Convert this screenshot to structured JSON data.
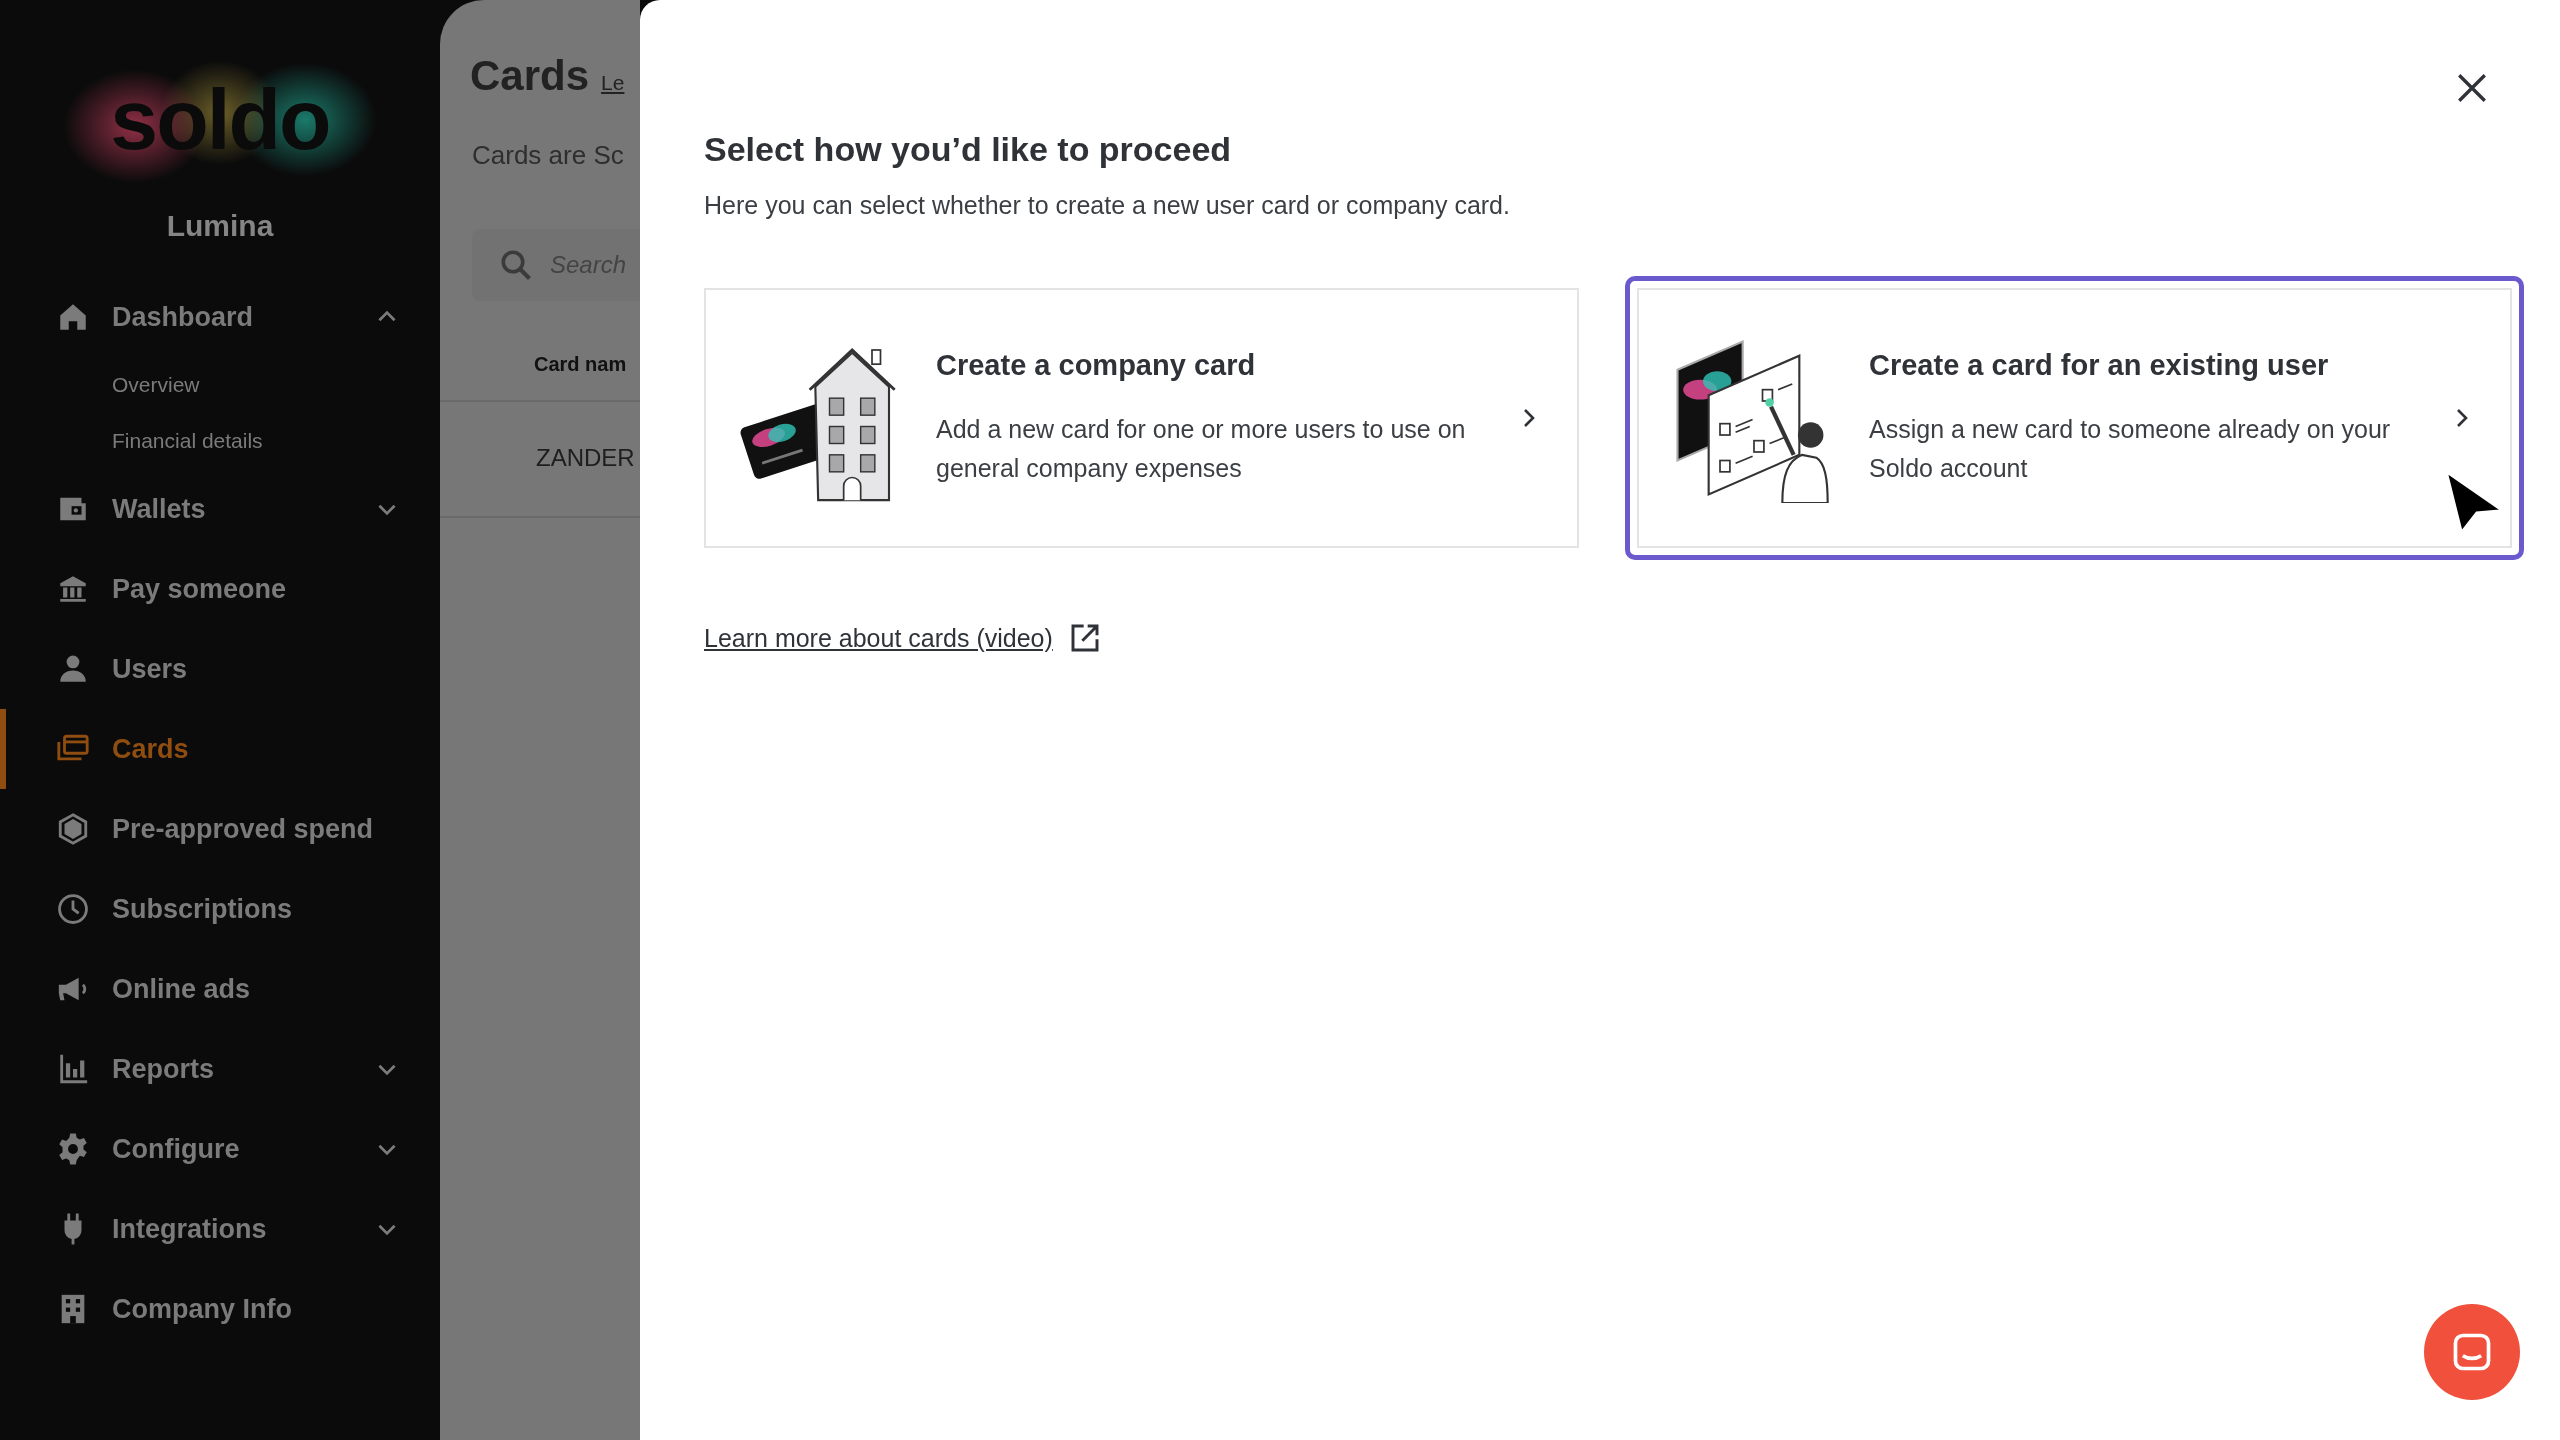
{
  "sidebar": {
    "logo": "soldo",
    "company": "Lumina",
    "items": [
      {
        "label": "Dashboard",
        "selected": false,
        "expanded": true,
        "children": [
          {
            "label": "Overview"
          },
          {
            "label": "Financial details"
          }
        ]
      },
      {
        "label": "Wallets",
        "selected": false,
        "expanded": false
      },
      {
        "label": "Pay someone",
        "selected": false
      },
      {
        "label": "Users",
        "selected": false
      },
      {
        "label": "Cards",
        "selected": true
      },
      {
        "label": "Pre-approved spend",
        "selected": false
      },
      {
        "label": "Subscriptions",
        "selected": false
      },
      {
        "label": "Online ads",
        "selected": false
      },
      {
        "label": "Reports",
        "selected": false,
        "expanded": false
      },
      {
        "label": "Configure",
        "selected": false,
        "expanded": false
      },
      {
        "label": "Integrations",
        "selected": false,
        "expanded": false
      },
      {
        "label": "Company Info",
        "selected": false
      }
    ]
  },
  "page": {
    "title": "Cards",
    "title_link": "Le",
    "intro": "Cards are Sc",
    "search": {
      "placeholder": "Search"
    },
    "table": {
      "columns": [
        "Card nam"
      ],
      "rows": [
        [
          "ZANDER"
        ]
      ]
    }
  },
  "dialog": {
    "title": "Select how you’d like to proceed",
    "subtitle": "Here you can select whether to create a new user card or company card.",
    "options": [
      {
        "kind": "company",
        "title": "Create a company card",
        "description": "Add a new card for one or more users to use on general company expenses",
        "selected": false
      },
      {
        "kind": "user",
        "title": "Create a card for an existing user",
        "description": "Assign a new card to someone already on your Soldo account",
        "selected": true
      }
    ],
    "link": "Learn more about cards (video)"
  }
}
